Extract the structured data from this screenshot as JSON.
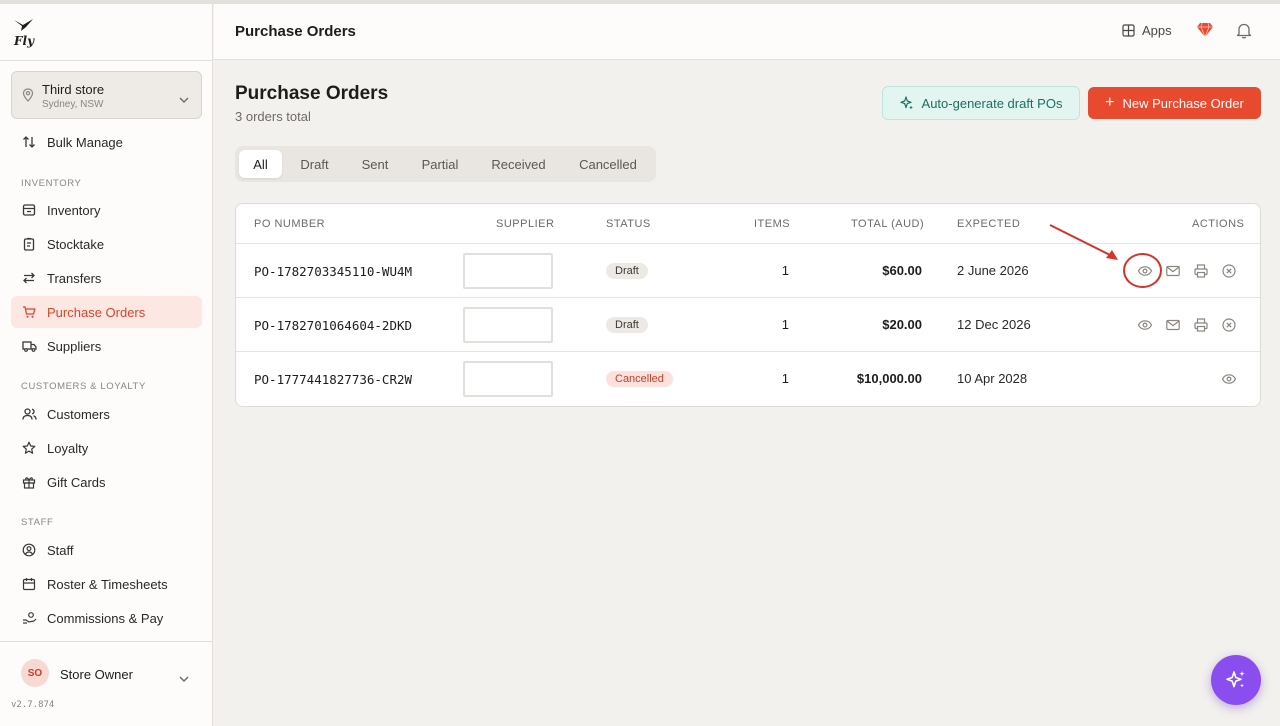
{
  "app": {
    "logo_text": "Fly",
    "version": "v2.7.874"
  },
  "store": {
    "name": "Third store",
    "location": "Sydney, NSW"
  },
  "sidebar": {
    "bulk_manage": "Bulk Manage",
    "sections": [
      {
        "label": "INVENTORY",
        "items": [
          "Inventory",
          "Stocktake",
          "Transfers",
          "Purchase Orders",
          "Suppliers"
        ]
      },
      {
        "label": "CUSTOMERS & LOYALTY",
        "items": [
          "Customers",
          "Loyalty",
          "Gift Cards"
        ]
      },
      {
        "label": "STAFF",
        "items": [
          "Staff",
          "Roster & Timesheets",
          "Commissions & Pay"
        ]
      }
    ],
    "active_item": "Purchase Orders"
  },
  "user": {
    "initials": "SO",
    "name": "Store Owner"
  },
  "header": {
    "title": "Purchase Orders",
    "apps_label": "Apps"
  },
  "page": {
    "title": "Purchase Orders",
    "subtitle": "3 orders total",
    "auto_generate_label": "Auto-generate draft POs",
    "new_po_label": "New Purchase Order"
  },
  "tabs": [
    "All",
    "Draft",
    "Sent",
    "Partial",
    "Received",
    "Cancelled"
  ],
  "active_tab": "All",
  "table": {
    "headers": {
      "po_number": "PO NUMBER",
      "supplier": "SUPPLIER",
      "status": "STATUS",
      "items": "ITEMS",
      "total": "TOTAL (AUD)",
      "expected": "EXPECTED",
      "actions": "ACTIONS"
    },
    "rows": [
      {
        "po_number": "PO-1782703345110-WU4M",
        "supplier": "",
        "status": "Draft",
        "items": "1",
        "total": "$60.00",
        "expected": "2 June 2026",
        "actions": [
          "view",
          "email",
          "print",
          "cancel"
        ]
      },
      {
        "po_number": "PO-1782701064604-2DKD",
        "supplier": "",
        "status": "Draft",
        "items": "1",
        "total": "$20.00",
        "expected": "12 Dec 2026",
        "actions": [
          "view",
          "email",
          "print",
          "cancel"
        ]
      },
      {
        "po_number": "PO-1777441827736-CR2W",
        "supplier": "",
        "status": "Cancelled",
        "items": "1",
        "total": "$10,000.00",
        "expected": "10 Apr 2028",
        "actions": [
          "view"
        ]
      }
    ]
  },
  "colors": {
    "accent": "#e84a2f",
    "active_nav_bg": "#fde7e2",
    "teal_button_bg": "#e3f5f1",
    "fab": "#8a4df0",
    "annotation": "#d8322a"
  }
}
